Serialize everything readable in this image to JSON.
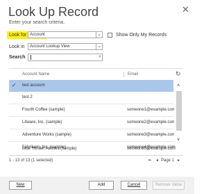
{
  "dialog": {
    "title": "Look Up Record",
    "subtitle": "Enter your search criteria.",
    "close_glyph": "✕"
  },
  "form": {
    "look_for_label": "Look for",
    "look_for_value": "Account",
    "only_my_records_label": "Show Only My Records",
    "only_my_records_checked": false,
    "look_in_label": "Look in",
    "look_in_value": "Account Lookup View",
    "search_label": "Search",
    "search_value": "",
    "dropdown_glyph": "⌄",
    "search_glyph": "⌕"
  },
  "grid": {
    "columns": [
      "Account Name",
      "Email"
    ],
    "refresh_glyph": "↻",
    "rows": [
      {
        "name": "test account",
        "email": "",
        "selected": true
      },
      {
        "name": "test 2",
        "email": "",
        "selected": false
      },
      {
        "name": "Fourth Coffee (sample)",
        "email": "someone1@example.com",
        "selected": false
      },
      {
        "name": "Litware, Inc. (sample)",
        "email": "someone2@example.com",
        "selected": false
      },
      {
        "name": "Adventure Works (sample)",
        "email": "someone3@example.com",
        "selected": false
      },
      {
        "name": "Fabrikam, Inc. (sample)",
        "email": "someone4@example.com",
        "selected": false
      },
      {
        "name": "Blue Yonder Airlines (sample)",
        "email": "someone5@example.com",
        "selected": false
      }
    ],
    "selected_glyph": "✓",
    "scroll_up_glyph": "˄",
    "scroll_down_glyph": "˅"
  },
  "pagination": {
    "status": "1 - 13 of 13 (1 selected)",
    "first_glyph": "⇤",
    "prev_glyph": "◂",
    "page_label": "Page 1",
    "next_glyph": "▸"
  },
  "buttons": {
    "new": "New",
    "add": "Add",
    "cancel": "Cancel",
    "remove_value": "Remove Value"
  },
  "colors": {
    "highlight": "#fff100",
    "selected_row": "#a9c7ea"
  }
}
